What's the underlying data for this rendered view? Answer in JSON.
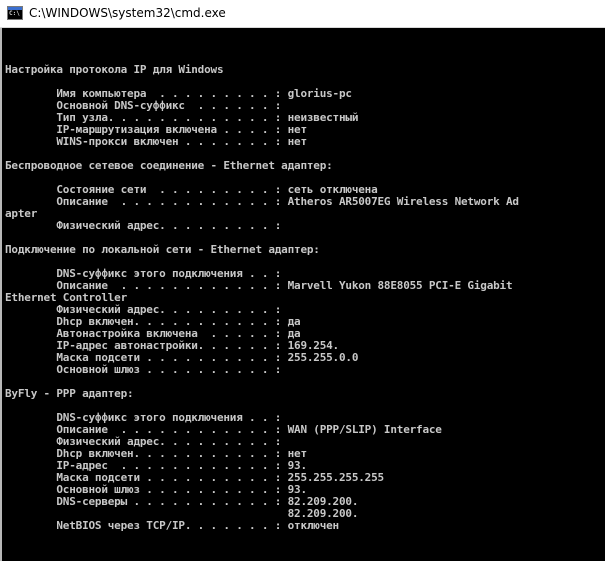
{
  "window": {
    "title": "C:\\WINDOWS\\system32\\cmd.exe",
    "icon_label": "C:\\",
    "icon": "cmd-console-icon"
  },
  "console": {
    "lines": [
      "Настройка протокола IP для Windows",
      "",
      "        Имя компьютера  . . . . . . . . . : glorius-pc",
      "        Основной DNS-суффикс  . . . . . . :",
      "        Тип узла. . . . . . . . . . . . . : неизвестный",
      "        IP-маршрутизация включена . . . . : нет",
      "        WINS-прокси включен . . . . . . . : нет",
      "",
      "Беспроводное сетевое соединение - Ethernet адаптер:",
      "",
      "        Состояние сети  . . . . . . . . . : сеть отключена",
      "        Описание  . . . . . . . . . . . . : Atheros AR5007EG Wireless Network Ad",
      "apter",
      "        Физический адрес. . . . . . . . . :",
      "",
      "Подключение по локальной сети - Ethernet адаптер:",
      "",
      "        DNS-суффикс этого подключения . . :",
      "        Описание  . . . . . . . . . . . . : Marvell Yukon 88E8055 PCI-E Gigabit",
      "Ethernet Controller",
      "        Физический адрес. . . . . . . . . :",
      "        Dhcp включен. . . . . . . . . . . : да",
      "        Автонастройка включена  . . . . . : да",
      "        IP-адрес автонастройки. . . . . . : 169.254.",
      "        Маска подсети . . . . . . . . . . : 255.255.0.0",
      "        Основной шлюз . . . . . . . . . . :",
      "",
      "ByFly - PPP адаптер:",
      "",
      "        DNS-суффикс этого подключения . . :",
      "        Описание  . . . . . . . . . . . . : WAN (PPP/SLIP) Interface",
      "        Физический адрес. . . . . . . . . :",
      "        Dhcp включен. . . . . . . . . . . : нет",
      "        IP-адрес  . . . . . . . . . . . . : 93.",
      "        Маска подсети . . . . . . . . . . : 255.255.255.255",
      "        Основной шлюз . . . . . . . . . . : 93.",
      "        DNS-серверы . . . . . . . . . . . : 82.209.200.",
      "                                            82.209.200.",
      "        NetBIOS через TCP/IP. . . . . . . : отключен"
    ]
  },
  "colors": {
    "background": "#000000",
    "text": "#c8c8c8",
    "titlebar": "#ffffff"
  }
}
